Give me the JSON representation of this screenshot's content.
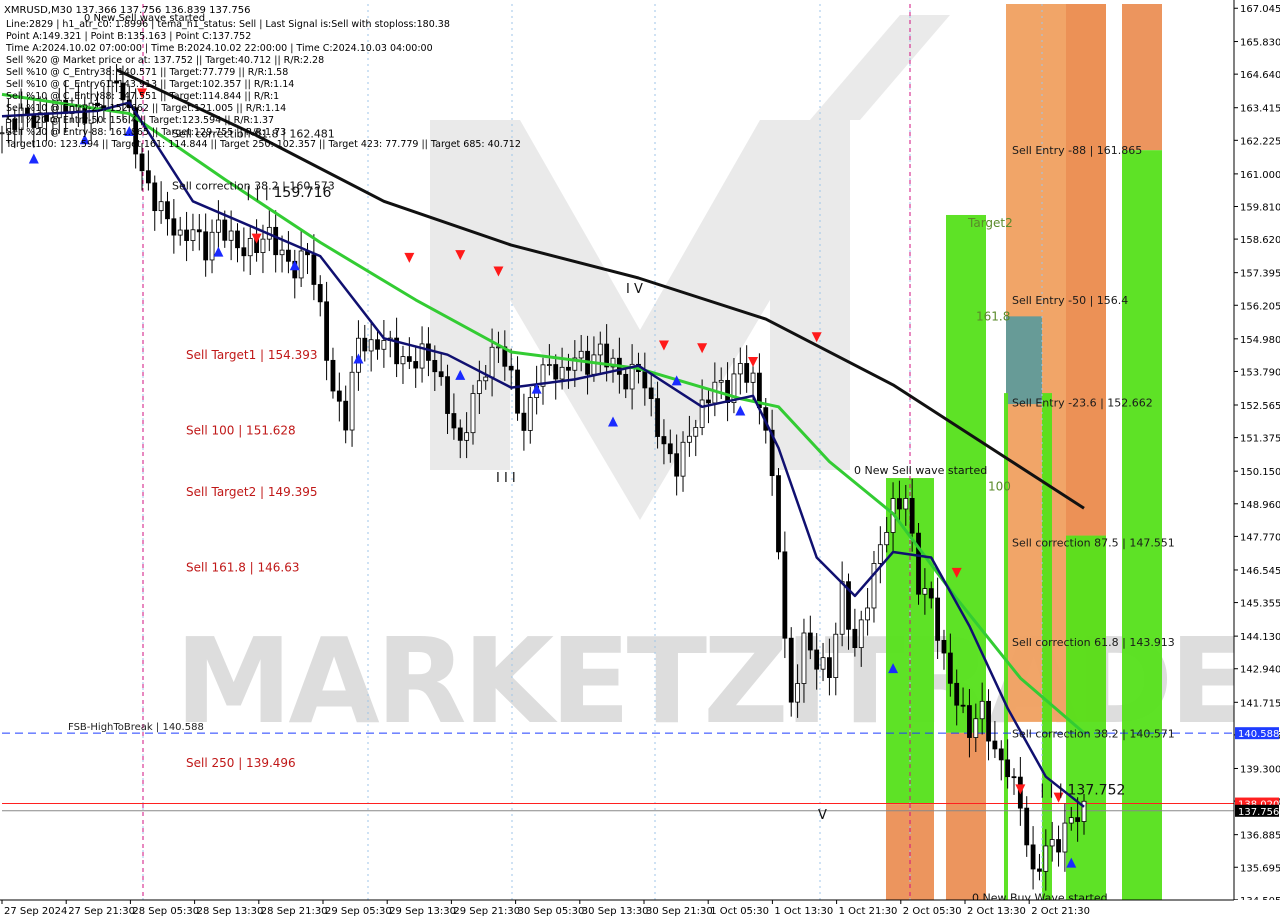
{
  "chart_data": {
    "type": "candlestick",
    "symbol_line": "XMRUSD,M30  137.366 137.756 136.839 137.756",
    "header_lines": [
      "Line:2829 | h1_atr_c0: 1.8996 | tema_h1_status: Sell | Last Signal is:Sell with stoploss:180.38",
      "Point A:149.321 | Point B:135.163 | Point C:137.752",
      "Time A:2024.10.02 07:00:00 | Time B:2024.10.02 22:00:00 | Time C:2024.10.03 04:00:00",
      "Sell %20 @ Market price or at: 137.752 || Target:40.712 || R/R:2.28",
      "Sell %10 @ C_Entry38: 140.571 || Target:77.779 || R/R:1.58",
      "Sell %10 @ C_Entry61: 143.913 || Target:102.357 || R/R:1.14",
      "Sell %10 @ C_Entry88: 147.551 || Target:114.844 || R/R:1",
      "Sell %10 @ Entry-23: 152.662 || Target:121.005 || R/R:1.14",
      "Sell %20 @ Entry-50: 156.4 || Target:123.594 || R/R:1.37",
      "Sell %20 @ Entry-88: 161.865 || Target:129.755 || R/R:1.73",
      "Target100: 123.594 || Target 161: 114.844 || Target 250: 102.357 || Target 423: 77.779 || Target 685: 40.712"
    ],
    "new_wave_label_top": "0 New Sell wave started",
    "y_axis": {
      "min": 134.5,
      "max": 167.2,
      "ticks": [
        167.045,
        165.83,
        164.64,
        163.415,
        162.225,
        161.0,
        159.81,
        158.62,
        157.395,
        156.205,
        154.98,
        153.79,
        152.565,
        151.375,
        150.15,
        148.96,
        147.77,
        146.545,
        145.355,
        144.13,
        142.94,
        141.715,
        140.525,
        139.3,
        138.11,
        136.885,
        135.695,
        134.505
      ],
      "price_tags": [
        {
          "label": "140.588",
          "value": 140.588,
          "color": "#1e3cff"
        },
        {
          "label": "138.020",
          "value": 138.02,
          "color": "#ff2020"
        },
        {
          "label": "137.756",
          "value": 137.756,
          "color": "#000000"
        }
      ]
    },
    "x_axis": {
      "labels": [
        "27 Sep 2024",
        "27 Sep 21:30",
        "28 Sep 05:30",
        "28 Sep 13:30",
        "28 Sep 21:30",
        "29 Sep 05:30",
        "29 Sep 13:30",
        "29 Sep 21:30",
        "30 Sep 05:30",
        "30 Sep 13:30",
        "30 Sep 21:30",
        "1 Oct 05:30",
        "1 Oct 13:30",
        "1 Oct 21:30",
        "2 Oct 05:30",
        "2 Oct 13:30",
        "2 Oct 21:30"
      ]
    },
    "close_path": [
      {
        "i": 0,
        "v": 162.5
      },
      {
        "i": 3,
        "v": 163.2
      },
      {
        "i": 6,
        "v": 162.9
      },
      {
        "i": 10,
        "v": 163.5
      },
      {
        "i": 13,
        "v": 163.2
      },
      {
        "i": 16,
        "v": 163.6
      },
      {
        "i": 18,
        "v": 164.5
      },
      {
        "i": 20,
        "v": 163.1
      },
      {
        "i": 22,
        "v": 161.0
      },
      {
        "i": 24,
        "v": 160.0
      },
      {
        "i": 26,
        "v": 159.4
      },
      {
        "i": 28,
        "v": 158.6
      },
      {
        "i": 30,
        "v": 159.0
      },
      {
        "i": 32,
        "v": 158.2
      },
      {
        "i": 34,
        "v": 159.2
      },
      {
        "i": 36,
        "v": 158.6
      },
      {
        "i": 38,
        "v": 158.2
      },
      {
        "i": 40,
        "v": 158.4
      },
      {
        "i": 42,
        "v": 158.8
      },
      {
        "i": 44,
        "v": 158.0
      },
      {
        "i": 46,
        "v": 157.5
      },
      {
        "i": 48,
        "v": 158.2
      },
      {
        "i": 50,
        "v": 156.0
      },
      {
        "i": 52,
        "v": 153.0
      },
      {
        "i": 54,
        "v": 152.0
      },
      {
        "i": 56,
        "v": 155.0
      },
      {
        "i": 58,
        "v": 154.6
      },
      {
        "i": 60,
        "v": 155.0
      },
      {
        "i": 62,
        "v": 154.4
      },
      {
        "i": 64,
        "v": 154.0
      },
      {
        "i": 66,
        "v": 154.5
      },
      {
        "i": 68,
        "v": 154.0
      },
      {
        "i": 70,
        "v": 152.5
      },
      {
        "i": 72,
        "v": 151.0
      },
      {
        "i": 74,
        "v": 152.8
      },
      {
        "i": 76,
        "v": 153.9
      },
      {
        "i": 78,
        "v": 154.8
      },
      {
        "i": 80,
        "v": 153.5
      },
      {
        "i": 82,
        "v": 151.6
      },
      {
        "i": 84,
        "v": 153.6
      },
      {
        "i": 86,
        "v": 154.0
      },
      {
        "i": 88,
        "v": 153.6
      },
      {
        "i": 90,
        "v": 154.4
      },
      {
        "i": 92,
        "v": 154.0
      },
      {
        "i": 94,
        "v": 154.6
      },
      {
        "i": 96,
        "v": 154.0
      },
      {
        "i": 98,
        "v": 153.4
      },
      {
        "i": 100,
        "v": 154.0
      },
      {
        "i": 102,
        "v": 152.5
      },
      {
        "i": 104,
        "v": 151.0
      },
      {
        "i": 106,
        "v": 150.3
      },
      {
        "i": 108,
        "v": 151.5
      },
      {
        "i": 110,
        "v": 152.4
      },
      {
        "i": 112,
        "v": 153.4
      },
      {
        "i": 114,
        "v": 153.0
      },
      {
        "i": 116,
        "v": 154.0
      },
      {
        "i": 118,
        "v": 153.4
      },
      {
        "i": 120,
        "v": 151.8
      },
      {
        "i": 122,
        "v": 147.5
      },
      {
        "i": 123,
        "v": 144.0
      },
      {
        "i": 124,
        "v": 141.5
      },
      {
        "i": 126,
        "v": 144.0
      },
      {
        "i": 128,
        "v": 143.2
      },
      {
        "i": 130,
        "v": 142.8
      },
      {
        "i": 132,
        "v": 145.8
      },
      {
        "i": 134,
        "v": 143.6
      },
      {
        "i": 136,
        "v": 145.5
      },
      {
        "i": 138,
        "v": 147.5
      },
      {
        "i": 140,
        "v": 148.8
      },
      {
        "i": 142,
        "v": 149.2
      },
      {
        "i": 144,
        "v": 146.0
      },
      {
        "i": 146,
        "v": 145.4
      },
      {
        "i": 148,
        "v": 143.2
      },
      {
        "i": 150,
        "v": 141.8
      },
      {
        "i": 152,
        "v": 140.7
      },
      {
        "i": 154,
        "v": 141.5
      },
      {
        "i": 156,
        "v": 139.8
      },
      {
        "i": 158,
        "v": 139.3
      },
      {
        "i": 160,
        "v": 138.0
      },
      {
        "i": 162,
        "v": 135.3
      },
      {
        "i": 164,
        "v": 136.4
      },
      {
        "i": 166,
        "v": 136.6
      },
      {
        "i": 168,
        "v": 137.5
      },
      {
        "i": 170,
        "v": 137.756
      }
    ],
    "ema_slow_black": [
      {
        "i": 18,
        "v": 164.8
      },
      {
        "i": 40,
        "v": 162.4
      },
      {
        "i": 60,
        "v": 160.0
      },
      {
        "i": 80,
        "v": 158.4
      },
      {
        "i": 100,
        "v": 157.2
      },
      {
        "i": 120,
        "v": 155.7
      },
      {
        "i": 140,
        "v": 153.3
      },
      {
        "i": 158,
        "v": 150.6
      },
      {
        "i": 170,
        "v": 148.8
      }
    ],
    "ema_mid_green": [
      {
        "i": 0,
        "v": 163.9
      },
      {
        "i": 20,
        "v": 163.2
      },
      {
        "i": 35,
        "v": 160.8
      },
      {
        "i": 50,
        "v": 158.5
      },
      {
        "i": 65,
        "v": 156.4
      },
      {
        "i": 80,
        "v": 154.5
      },
      {
        "i": 100,
        "v": 153.9
      },
      {
        "i": 116,
        "v": 152.8
      },
      {
        "i": 122,
        "v": 152.5
      },
      {
        "i": 130,
        "v": 150.5
      },
      {
        "i": 140,
        "v": 148.6
      },
      {
        "i": 150,
        "v": 145.5
      },
      {
        "i": 160,
        "v": 142.6
      },
      {
        "i": 170,
        "v": 140.6
      }
    ],
    "ema_fast_navy": [
      {
        "i": 0,
        "v": 163.1
      },
      {
        "i": 15,
        "v": 163.3
      },
      {
        "i": 20,
        "v": 163.6
      },
      {
        "i": 30,
        "v": 160.0
      },
      {
        "i": 40,
        "v": 159.0
      },
      {
        "i": 50,
        "v": 158.0
      },
      {
        "i": 60,
        "v": 155.0
      },
      {
        "i": 70,
        "v": 154.4
      },
      {
        "i": 80,
        "v": 153.2
      },
      {
        "i": 90,
        "v": 153.5
      },
      {
        "i": 100,
        "v": 154.0
      },
      {
        "i": 110,
        "v": 152.5
      },
      {
        "i": 118,
        "v": 152.9
      },
      {
        "i": 122,
        "v": 151.0
      },
      {
        "i": 128,
        "v": 147.0
      },
      {
        "i": 134,
        "v": 145.6
      },
      {
        "i": 140,
        "v": 147.2
      },
      {
        "i": 146,
        "v": 147.0
      },
      {
        "i": 152,
        "v": 144.5
      },
      {
        "i": 158,
        "v": 141.5
      },
      {
        "i": 164,
        "v": 139.0
      },
      {
        "i": 170,
        "v": 137.9
      }
    ],
    "bar_count": 171,
    "x_plot_range": [
      2,
      1084
    ],
    "hlines": [
      {
        "value": 140.588,
        "color": "#1e3cff",
        "dash": "8,5",
        "label": "FSB-HighToBreak | 140.588"
      },
      {
        "value": 138.02,
        "color": "#ff2020",
        "dash": "",
        "label": ""
      },
      {
        "value": 137.756,
        "color": "#888888",
        "dash": "",
        "label": ""
      }
    ],
    "left_labels": [
      {
        "text": "Sell Target1 | 154.393",
        "value": 154.393
      },
      {
        "text": "Sell 100 | 151.628",
        "value": 151.628
      },
      {
        "text": "Sell Target2 | 149.395",
        "value": 149.395
      },
      {
        "text": "Sell 161.8 | 146.63",
        "value": 146.63
      },
      {
        "text": "Sell  250 | 139.496",
        "value": 139.496
      }
    ],
    "zone_labels": [
      {
        "text": "Sell Entry -88 | 161.865",
        "value": 161.865
      },
      {
        "text": "Sell Entry -50 | 156.4",
        "value": 156.4
      },
      {
        "text": "Sell Entry -23.6 | 152.662",
        "value": 152.662
      },
      {
        "text": "Sell correction 87.5 | 147.551",
        "value": 147.551
      },
      {
        "text": "Sell correction 61.8 | 143.913",
        "value": 143.913
      },
      {
        "text": "Sell correction 38.2 | 140.571",
        "value": 140.571
      }
    ],
    "annotations": [
      {
        "text": "| | | 159.716",
        "value": 160.3
      },
      {
        "text": "| | | 137.752",
        "value": 138.5
      },
      {
        "text": "Sell correction 38.2 | 160.573",
        "value": 160.573
      },
      {
        "text": "Sell correction 61.8 | 162.481",
        "value": 162.481
      },
      {
        "text": "I V",
        "value": 156.8
      },
      {
        "text": "I I I",
        "value": 149.9
      },
      {
        "text": "V",
        "value": 137.6
      },
      {
        "text": "Target2",
        "value": 159.2
      },
      {
        "text": "161.8",
        "value": 155.8
      },
      {
        "text": "100",
        "value": 149.6
      },
      {
        "text": "0 New Buy Wave started",
        "value": 134.6
      },
      {
        "text": "0 New Sell wave started",
        "value": 150.2
      }
    ],
    "watermark": "MARKETZITRADE"
  }
}
